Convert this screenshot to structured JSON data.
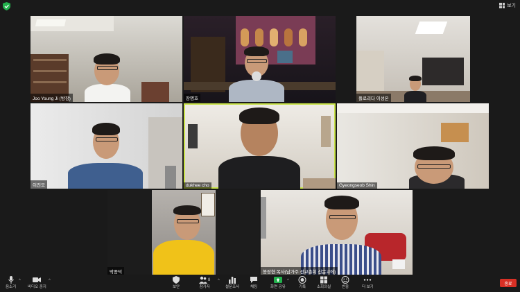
{
  "top_bar": {
    "view_label": "보기"
  },
  "participants": [
    {
      "name": "Joo Young Ji (방장)"
    },
    {
      "name": "장명호"
    },
    {
      "name": "플로리다 이성온"
    },
    {
      "name": "이진모"
    },
    {
      "name": "dukhee cho"
    },
    {
      "name": "Gyeongseob Shin"
    },
    {
      "name": "박종덕"
    },
    {
      "name": "봉장현 목사(남가주 선교총회 신문고에)"
    }
  ],
  "toolbar": {
    "mute": "음소거",
    "video": "비디오 중지",
    "security": "보안",
    "participants": "참가자",
    "participants_count": "8",
    "polls": "설문조사",
    "chat": "채팅",
    "share": "화면 공유",
    "record": "기록",
    "rooms": "소회의실",
    "reactions": "반응",
    "more": "더 보기",
    "end": "종료"
  },
  "colors": {
    "active_speaker": "#c9e34a",
    "end_button": "#d93025",
    "share_green": "#23b14d"
  }
}
